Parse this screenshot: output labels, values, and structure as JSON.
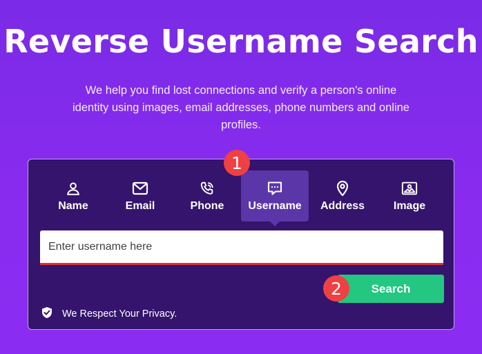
{
  "hero": {
    "title": "Reverse Username Search",
    "subtitle": "We help you find lost connections and verify a person's online identity using images, email addresses, phone numbers and online profiles."
  },
  "tabs": [
    {
      "label": "Name",
      "icon": "person-icon"
    },
    {
      "label": "Email",
      "icon": "envelope-icon"
    },
    {
      "label": "Phone",
      "icon": "phone-icon"
    },
    {
      "label": "Username",
      "icon": "chat-bubble-icon",
      "active": true
    },
    {
      "label": "Address",
      "icon": "map-pin-icon"
    },
    {
      "label": "Image",
      "icon": "image-icon"
    }
  ],
  "search": {
    "placeholder": "Enter username here",
    "value": "",
    "button_label": "Search"
  },
  "annotations": {
    "step1": "1",
    "step2": "2",
    "color": "#ef4044"
  },
  "privacy": {
    "text": "We Respect Your Privacy.",
    "icon": "shield-check-icon"
  },
  "colors": {
    "background": "#8a2bf0",
    "panel": "#34146c",
    "active_tab": "#5b36a8",
    "button": "#24c781",
    "input_underline": "#e0303a"
  }
}
